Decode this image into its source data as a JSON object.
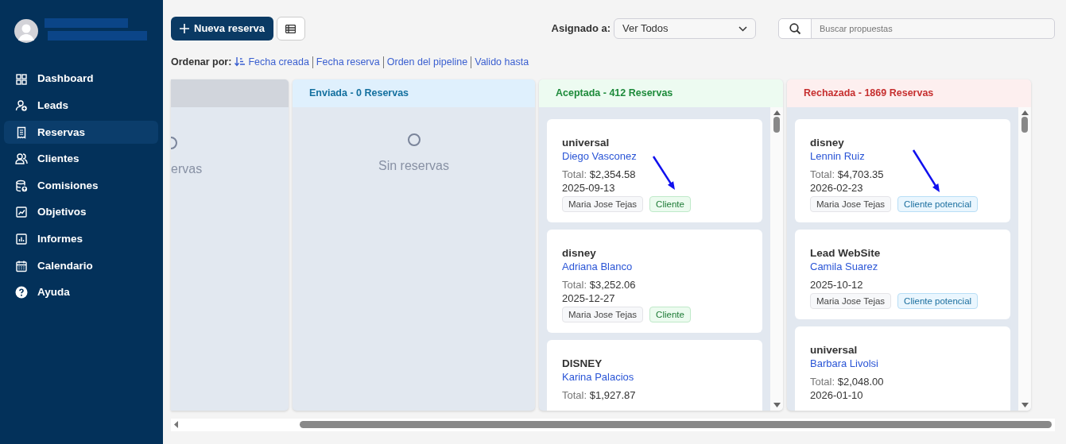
{
  "sidebar": {
    "items": [
      {
        "label": "Dashboard",
        "selected": false
      },
      {
        "label": "Leads",
        "selected": false
      },
      {
        "label": "Reservas",
        "selected": true
      },
      {
        "label": "Clientes",
        "selected": false
      },
      {
        "label": "Comisiones",
        "selected": false
      },
      {
        "label": "Objetivos",
        "selected": false
      },
      {
        "label": "Informes",
        "selected": false
      },
      {
        "label": "Calendario",
        "selected": false
      },
      {
        "label": "Ayuda",
        "selected": false
      }
    ]
  },
  "toolbar": {
    "new_button": "Nueva reserva",
    "assigned": {
      "label": "Asignado a:",
      "value": "Ver Todos"
    },
    "search": {
      "placeholder": "Buscar propuestas"
    }
  },
  "sort": {
    "label": "Ordenar por:",
    "options": [
      {
        "label": "Fecha creada",
        "selected": true
      },
      {
        "label": "Fecha reserva",
        "selected": false
      },
      {
        "label": "Orden del pipeline",
        "selected": false
      },
      {
        "label": "Valido hasta",
        "selected": false
      }
    ]
  },
  "columns": [
    {
      "kind": "neutral",
      "empty_text": "ervas",
      "scrollable": false
    },
    {
      "kind": "info",
      "title": "Enviada - 0 Reservas",
      "empty_text": "Sin reservas",
      "scrollable": false
    },
    {
      "kind": "success",
      "title": "Aceptada - 412 Reservas",
      "scrollable": true,
      "cards": [
        {
          "company": "universal",
          "contact": "Diego Vasconez",
          "total_label": "Total:",
          "total": "$2,354.58",
          "date": "2025-09-13",
          "agent": "Maria Jose Tejas",
          "tag": {
            "label": "Cliente",
            "kind": "client"
          },
          "arrow": true
        },
        {
          "company": "disney",
          "contact": "Adriana Blanco",
          "total_label": "Total:",
          "total": "$3,252.06",
          "date": "2025-12-27",
          "agent": "Maria Jose Tejas",
          "tag": {
            "label": "Cliente",
            "kind": "client"
          },
          "arrow": false
        },
        {
          "company": "DISNEY",
          "contact": "Karina Palacios",
          "total_label": "Total:",
          "total": "$1,927.87",
          "arrow": false
        }
      ]
    },
    {
      "kind": "danger",
      "title": "Rechazada - 1869 Reservas",
      "scrollable": true,
      "cards": [
        {
          "company": "disney",
          "contact": "Lennin Ruiz",
          "total_label": "Total:",
          "total": "$4,703.35",
          "date": "2026-02-23",
          "agent": "Maria Jose Tejas",
          "tag": {
            "label": "Cliente potencial",
            "kind": "prospect"
          },
          "arrow": true
        },
        {
          "company": "Lead WebSite",
          "contact": "Camila Suarez",
          "date": "2025-10-12",
          "agent": "Maria Jose Tejas",
          "tag": {
            "label": "Cliente potencial",
            "kind": "prospect"
          },
          "arrow": false
        },
        {
          "company": "universal",
          "contact": "Barbara Livolsi",
          "total_label": "Total:",
          "total": "$2,048.00",
          "date": "2026-01-10",
          "arrow": false
        }
      ]
    }
  ]
}
